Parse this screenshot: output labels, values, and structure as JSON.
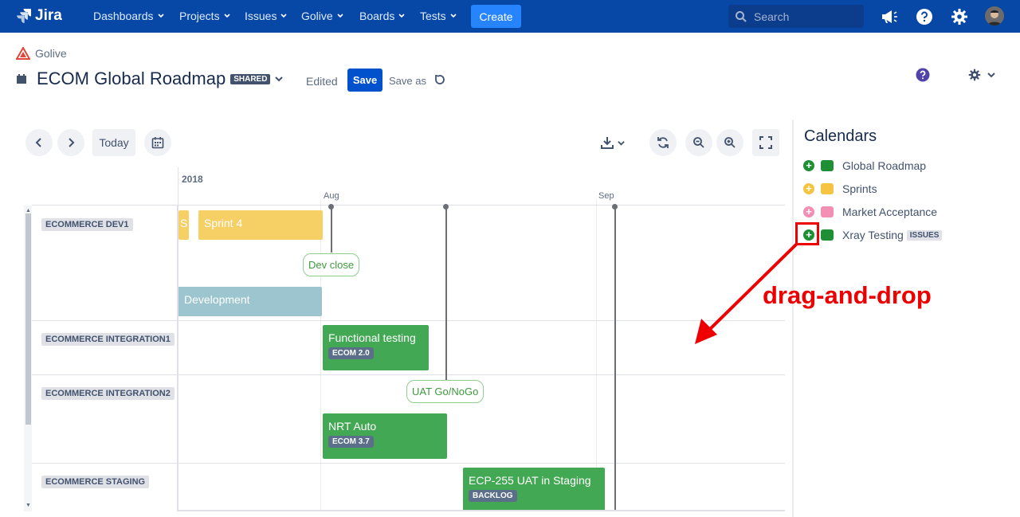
{
  "nav": {
    "logo": "Jira",
    "items": [
      "Dashboards",
      "Projects",
      "Issues",
      "Golive",
      "Boards",
      "Tests"
    ],
    "create": "Create",
    "search_placeholder": "Search"
  },
  "header": {
    "breadcrumb": "Golive",
    "title": "ECOM Global Roadmap",
    "shared_badge": "SHARED",
    "edited": "Edited",
    "save": "Save",
    "save_as": "Save as"
  },
  "toolbar": {
    "today": "Today"
  },
  "timeline": {
    "year": "2018",
    "months": [
      "Aug",
      "Sep"
    ],
    "rows": [
      "ECOMMERCE DEV1",
      "ECOMMERCE INTEGRATION1",
      "ECOMMERCE INTEGRATION2",
      "ECOMMERCE STAGING"
    ],
    "bars": [
      {
        "label": "S",
        "color": "#f6cf65"
      },
      {
        "label": "Sprint 4",
        "color": "#f6cf65"
      },
      {
        "label": "Development",
        "color": "#9cc5d0"
      },
      {
        "label": "Functional testing",
        "tag": "ECOM 2.0",
        "color": "#43a853"
      },
      {
        "label": "NRT Auto",
        "tag": "ECOM 3.7",
        "color": "#43a853"
      },
      {
        "label": "ECP-255 UAT in Staging",
        "tag": "BACKLOG",
        "color": "#43a853"
      }
    ],
    "milestones": [
      "Dev close",
      "UAT Go/NoGo"
    ]
  },
  "calendars": {
    "title": "Calendars",
    "items": [
      {
        "name": "Global Roadmap",
        "color": "#1e8f35",
        "plus_color": "#1e8f35"
      },
      {
        "name": "Sprints",
        "color": "#f6c342",
        "plus_color": "#f6c342"
      },
      {
        "name": "Market Acceptance",
        "color": "#f28fb3",
        "plus_color": "#f28fb3"
      },
      {
        "name": "Xray Testing",
        "color": "#1e8f35",
        "plus_color": "#1e8f35",
        "badge": "ISSUES"
      }
    ]
  },
  "annotation": "drag-and-drop"
}
